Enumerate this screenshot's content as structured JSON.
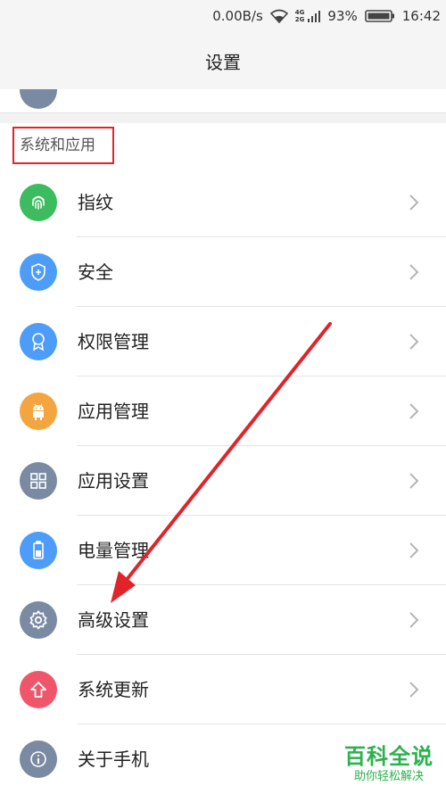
{
  "status_bar": {
    "net_speed": "0.00B/s",
    "signal_label_top": "4G",
    "signal_label_bottom": "2G",
    "battery": "93%",
    "time": "16:42"
  },
  "header": {
    "title": "设置"
  },
  "section": {
    "title": "系统和应用"
  },
  "items": [
    {
      "label": "指纹",
      "icon": "fingerprint-icon",
      "color": "#3dbb5f"
    },
    {
      "label": "安全",
      "icon": "shield-icon",
      "color": "#4d9cf8"
    },
    {
      "label": "权限管理",
      "icon": "badge-icon",
      "color": "#4d9cf8"
    },
    {
      "label": "应用管理",
      "icon": "android-icon",
      "color": "#f5a540"
    },
    {
      "label": "应用设置",
      "icon": "grid-icon",
      "color": "#7a8aa3"
    },
    {
      "label": "电量管理",
      "icon": "battery-icon",
      "color": "#4d9cf8"
    },
    {
      "label": "高级设置",
      "icon": "gear-icon",
      "color": "#7a8aa3"
    },
    {
      "label": "系统更新",
      "icon": "update-arrow-icon",
      "color": "#f0566a"
    },
    {
      "label": "关于手机",
      "icon": "info-icon",
      "color": "#7a8aa3"
    }
  ],
  "watermark": {
    "title": "百科全说",
    "subtitle": "助你轻松解决"
  },
  "annotation_colors": {
    "highlight": "#e0242a",
    "arrow": "#e0242a"
  }
}
